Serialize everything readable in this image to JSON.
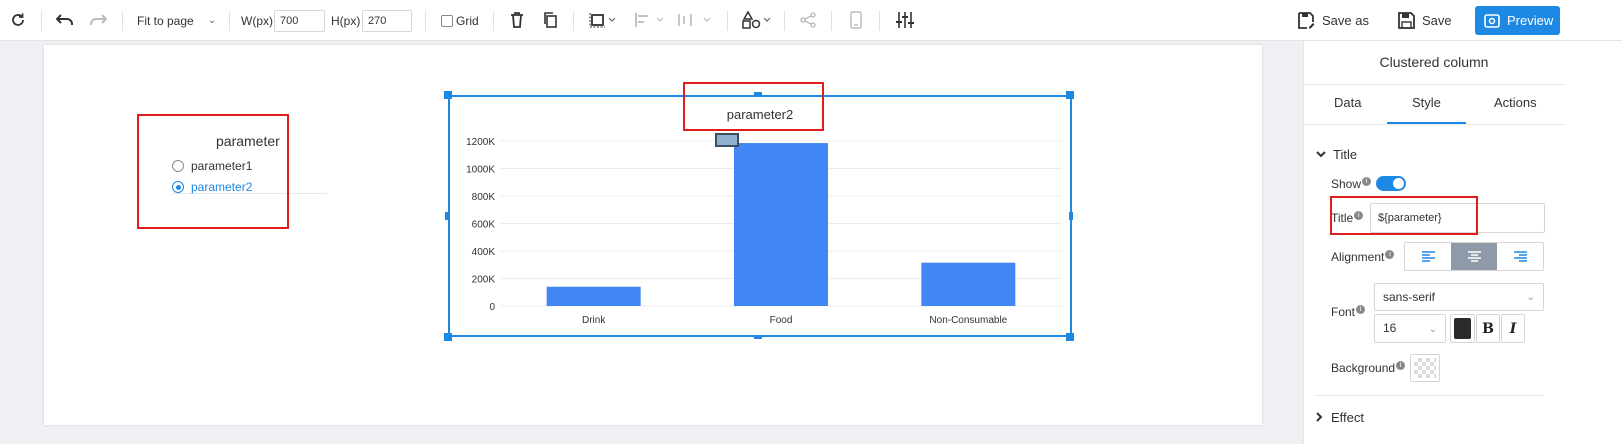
{
  "toolbar": {
    "zoom": "Fit to page",
    "width_label": "W(px)",
    "width_value": "700",
    "height_label": "H(px)",
    "height_value": "270",
    "grid_label": "Grid",
    "save_as_label": "Save as",
    "save_label": "Save",
    "preview_label": "Preview"
  },
  "radio_widget": {
    "title": "parameter",
    "options": [
      {
        "label": "parameter1",
        "selected": false
      },
      {
        "label": "parameter2",
        "selected": true
      }
    ]
  },
  "chart": {
    "title": "parameter2"
  },
  "chart_data": {
    "type": "bar",
    "title": "parameter2",
    "categories": [
      "Drink",
      "Food",
      "Non-Consumable"
    ],
    "values": [
      140000,
      1185000,
      315000
    ],
    "yticks": [
      "0",
      "200K",
      "400K",
      "600K",
      "800K",
      "1000K",
      "1200K"
    ],
    "ylim": [
      0,
      1200000
    ],
    "grid": true,
    "color": "#4285f4"
  },
  "panel": {
    "title": "Clustered column",
    "tabs": [
      "Data",
      "Style",
      "Actions"
    ],
    "active_tab": "Style",
    "section_title": "Title",
    "show_label": "Show",
    "title_label": "Title",
    "title_value": "${parameter}",
    "alignment_label": "Alignment",
    "font_label": "Font",
    "font_family": "sans-serif",
    "font_size": "16",
    "bold_label": "B",
    "italic_label": "I",
    "background_label": "Background",
    "text_color": "#2a2a2a",
    "next_section": "Effect"
  }
}
